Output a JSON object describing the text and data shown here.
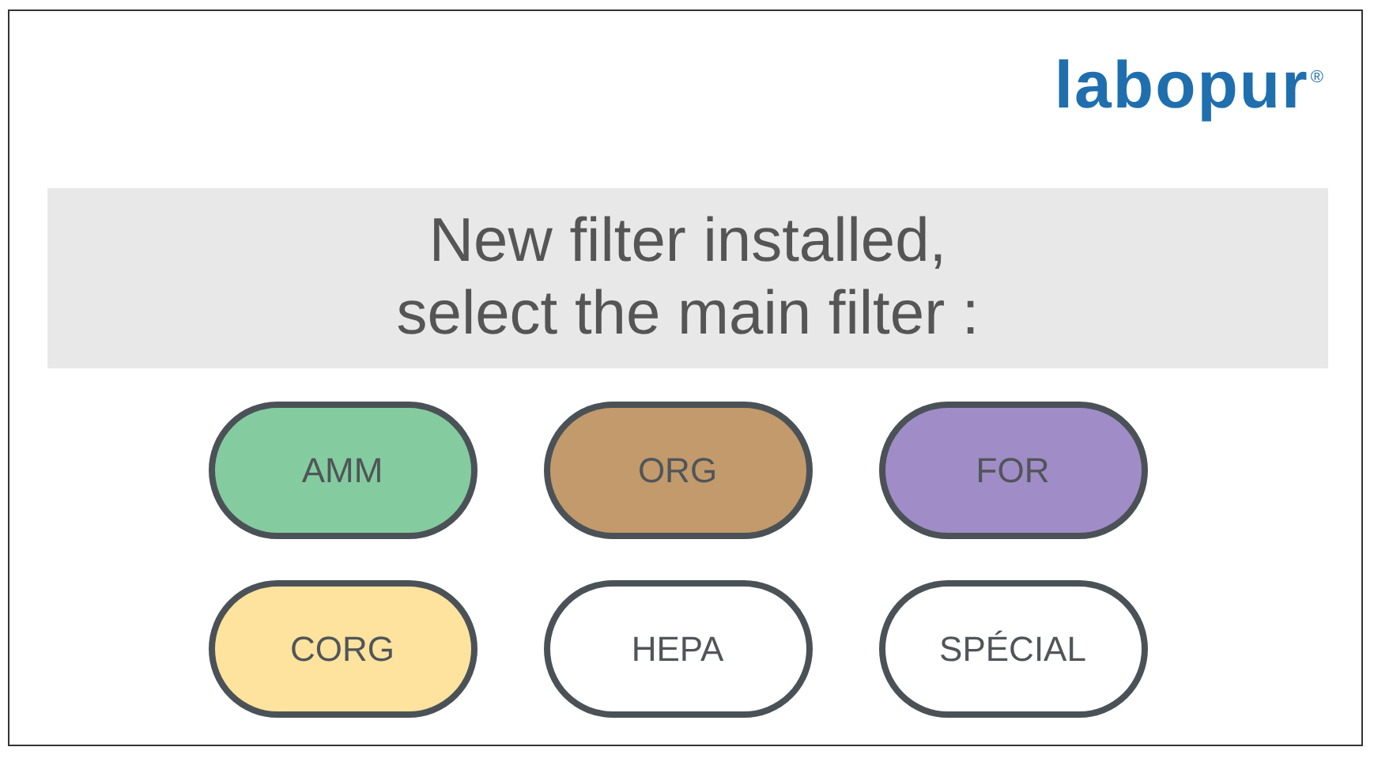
{
  "logo": {
    "name": "labopur",
    "mark": "®"
  },
  "message": [
    "New filter installed,",
    "select the main filter :"
  ],
  "filters": [
    {
      "label": "AMM",
      "color": "#84cc9f"
    },
    {
      "label": "ORG",
      "color": "#c29a6b"
    },
    {
      "label": "FOR",
      "color": "#a08cc6"
    },
    {
      "label": "CORG",
      "color": "#fde39e"
    },
    {
      "label": "HEPA",
      "color": "#ffffff"
    },
    {
      "label": "SPÉCIAL",
      "color": "#ffffff"
    }
  ]
}
